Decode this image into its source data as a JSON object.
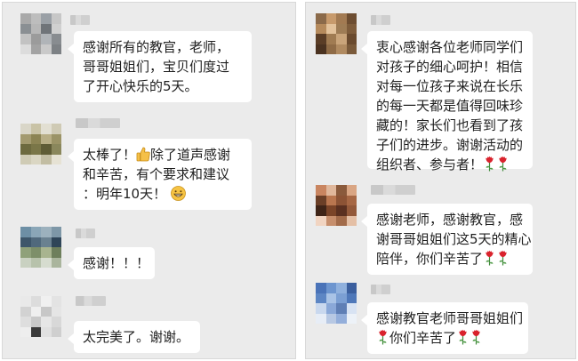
{
  "left": {
    "messages": [
      {
        "lines": [
          "感谢所有的教官，老师，",
          "哥哥姐姐们，宝贝们度过",
          "了开心快乐的5天。"
        ]
      },
      {
        "line1a": "太棒了！",
        "line1b": "除了道声感谢",
        "line2": "和辛苦，有个要求和建议",
        "line3": "：明年10天！",
        "emojis": [
          "thumbs-up-icon",
          "grin-emoji-icon"
        ]
      },
      {
        "lines": [
          "感谢！！！"
        ]
      },
      {
        "lines": [
          "太完美了。谢谢。"
        ]
      }
    ]
  },
  "right": {
    "messages": [
      {
        "lines": [
          "衷心感谢各位老师同学们",
          "对孩子的细心呵护！相信",
          "对每一位孩子来说在长乐",
          "的每一天都是值得回味珍",
          "藏的！家长们也看到了孩",
          "子们的进步。谢谢活动的",
          "组织者、参与者！"
        ],
        "emojis": [
          "rose-icon",
          "rose-icon"
        ]
      },
      {
        "lines": [
          "感谢老师，感谢教官，感",
          "谢哥哥姐姐们这5天的精心",
          "陪伴，你们辛苦了"
        ],
        "emojis": [
          "rose-icon",
          "rose-icon"
        ]
      },
      {
        "lines": [
          "感谢教官老师哥哥姐姐们",
          "你们辛苦了"
        ],
        "emojis": [
          "rose-icon",
          "rose-icon",
          "rose-icon"
        ]
      }
    ]
  },
  "colors": {
    "panel": "#ebebeb",
    "bubble": "#ffffff",
    "text": "#1f1f1f",
    "rose": "#d9232d"
  }
}
